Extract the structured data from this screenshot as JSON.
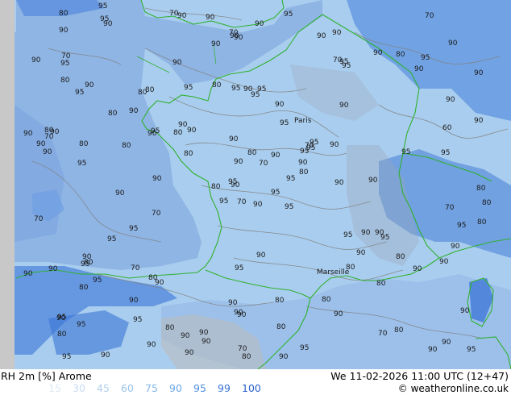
{
  "footer": {
    "title": "RH 2m [%] Arome",
    "datetime": "We 11-02-2026 11:00 UTC (12+47)",
    "credit": "© weatheronline.co.uk"
  },
  "legend": {
    "values": [
      "15",
      "30",
      "45",
      "60",
      "75",
      "90",
      "95",
      "99",
      "100"
    ],
    "colors": [
      "#dce8f4",
      "#c6dcf0",
      "#b0cfec",
      "#98c2ea",
      "#82b6e8",
      "#6aa8e8",
      "#4f8fe0",
      "#3a74d6",
      "#2a5fc8"
    ]
  },
  "map": {
    "city_label": "Paris",
    "city_label_2": "Marseille",
    "colors": {
      "base": "#a9cdee",
      "sea": "#7fa6e0",
      "humid": "#4a82dc",
      "border": "#2fb12f",
      "contour": "#808080",
      "outside": "#c8c8c8"
    },
    "isolines": [
      {
        "v": "90"
      },
      {
        "v": "95"
      },
      {
        "v": "90"
      },
      {
        "v": "95"
      },
      {
        "v": "95"
      },
      {
        "v": "90"
      },
      {
        "v": "90"
      },
      {
        "v": "95"
      },
      {
        "v": "95"
      },
      {
        "v": "95"
      },
      {
        "v": "90"
      },
      {
        "v": "95"
      },
      {
        "v": "95"
      },
      {
        "v": "90"
      },
      {
        "v": "95"
      },
      {
        "v": "90"
      },
      {
        "v": "90"
      },
      {
        "v": "95"
      },
      {
        "v": "95"
      },
      {
        "v": "95"
      },
      {
        "v": "90"
      },
      {
        "v": "80"
      },
      {
        "v": "95"
      },
      {
        "v": "90"
      },
      {
        "v": "95"
      },
      {
        "v": "95"
      },
      {
        "v": "90"
      },
      {
        "v": "90"
      },
      {
        "v": "90"
      },
      {
        "v": "95"
      },
      {
        "v": "90"
      },
      {
        "v": "95"
      },
      {
        "v": "90"
      },
      {
        "v": "90"
      },
      {
        "v": "80"
      },
      {
        "v": "90"
      },
      {
        "v": "80"
      },
      {
        "v": "90"
      },
      {
        "v": "90"
      },
      {
        "v": "90"
      },
      {
        "v": "95"
      },
      {
        "v": "80"
      },
      {
        "v": "80"
      },
      {
        "v": "80"
      },
      {
        "v": "90"
      },
      {
        "v": "90"
      },
      {
        "v": "90"
      },
      {
        "v": "95"
      },
      {
        "v": "90"
      },
      {
        "v": "80"
      },
      {
        "v": "80"
      },
      {
        "v": "90"
      },
      {
        "v": "90"
      },
      {
        "v": "90"
      },
      {
        "v": "90"
      },
      {
        "v": "90"
      },
      {
        "v": "95"
      },
      {
        "v": "80"
      },
      {
        "v": "80"
      },
      {
        "v": "95"
      },
      {
        "v": "90"
      },
      {
        "v": "90"
      },
      {
        "v": "90"
      },
      {
        "v": "90"
      },
      {
        "v": "80"
      },
      {
        "v": "95"
      },
      {
        "v": "90"
      },
      {
        "v": "90"
      },
      {
        "v": "80"
      },
      {
        "v": "90"
      },
      {
        "v": "95"
      },
      {
        "v": "90"
      },
      {
        "v": "90"
      },
      {
        "v": "90"
      },
      {
        "v": "90"
      },
      {
        "v": "90"
      },
      {
        "v": "80"
      },
      {
        "v": "70"
      },
      {
        "v": "90"
      },
      {
        "v": "80"
      },
      {
        "v": "90"
      },
      {
        "v": "95"
      },
      {
        "v": "90"
      },
      {
        "v": "90"
      },
      {
        "v": "70"
      },
      {
        "v": "95"
      },
      {
        "v": "90"
      },
      {
        "v": "80"
      },
      {
        "v": "90"
      },
      {
        "v": "80"
      },
      {
        "v": "70"
      },
      {
        "v": "80"
      },
      {
        "v": "90"
      },
      {
        "v": "80"
      },
      {
        "v": "70"
      },
      {
        "v": "90"
      },
      {
        "v": "70"
      },
      {
        "v": "80"
      },
      {
        "v": "70"
      },
      {
        "v": "95"
      },
      {
        "v": "90"
      },
      {
        "v": "70"
      },
      {
        "v": "80"
      },
      {
        "v": "90"
      },
      {
        "v": "95"
      },
      {
        "v": "70"
      },
      {
        "v": "80"
      },
      {
        "v": "70"
      },
      {
        "v": "90"
      },
      {
        "v": "80"
      },
      {
        "v": "70"
      },
      {
        "v": "95"
      },
      {
        "v": "95"
      },
      {
        "v": "80"
      },
      {
        "v": "90"
      },
      {
        "v": "90"
      },
      {
        "v": "70"
      },
      {
        "v": "90"
      },
      {
        "v": "80"
      },
      {
        "v": "90"
      },
      {
        "v": "95"
      },
      {
        "v": "70"
      },
      {
        "v": "90"
      },
      {
        "v": "95"
      },
      {
        "v": "90"
      },
      {
        "v": "95"
      },
      {
        "v": "90"
      },
      {
        "v": "90"
      },
      {
        "v": "95"
      },
      {
        "v": "80"
      },
      {
        "v": "80"
      },
      {
        "v": "95"
      },
      {
        "v": "95"
      },
      {
        "v": "90"
      },
      {
        "v": "95"
      },
      {
        "v": "80"
      },
      {
        "v": "70"
      },
      {
        "v": "90"
      },
      {
        "v": "80"
      },
      {
        "v": "90"
      },
      {
        "v": "95"
      },
      {
        "v": "80"
      },
      {
        "v": "90"
      },
      {
        "v": "95"
      },
      {
        "v": "95"
      },
      {
        "v": "70"
      },
      {
        "v": "90"
      },
      {
        "v": "70"
      },
      {
        "v": "90"
      },
      {
        "v": "90"
      },
      {
        "v": "60"
      },
      {
        "v": "80"
      },
      {
        "v": "80"
      },
      {
        "v": "90"
      }
    ]
  }
}
